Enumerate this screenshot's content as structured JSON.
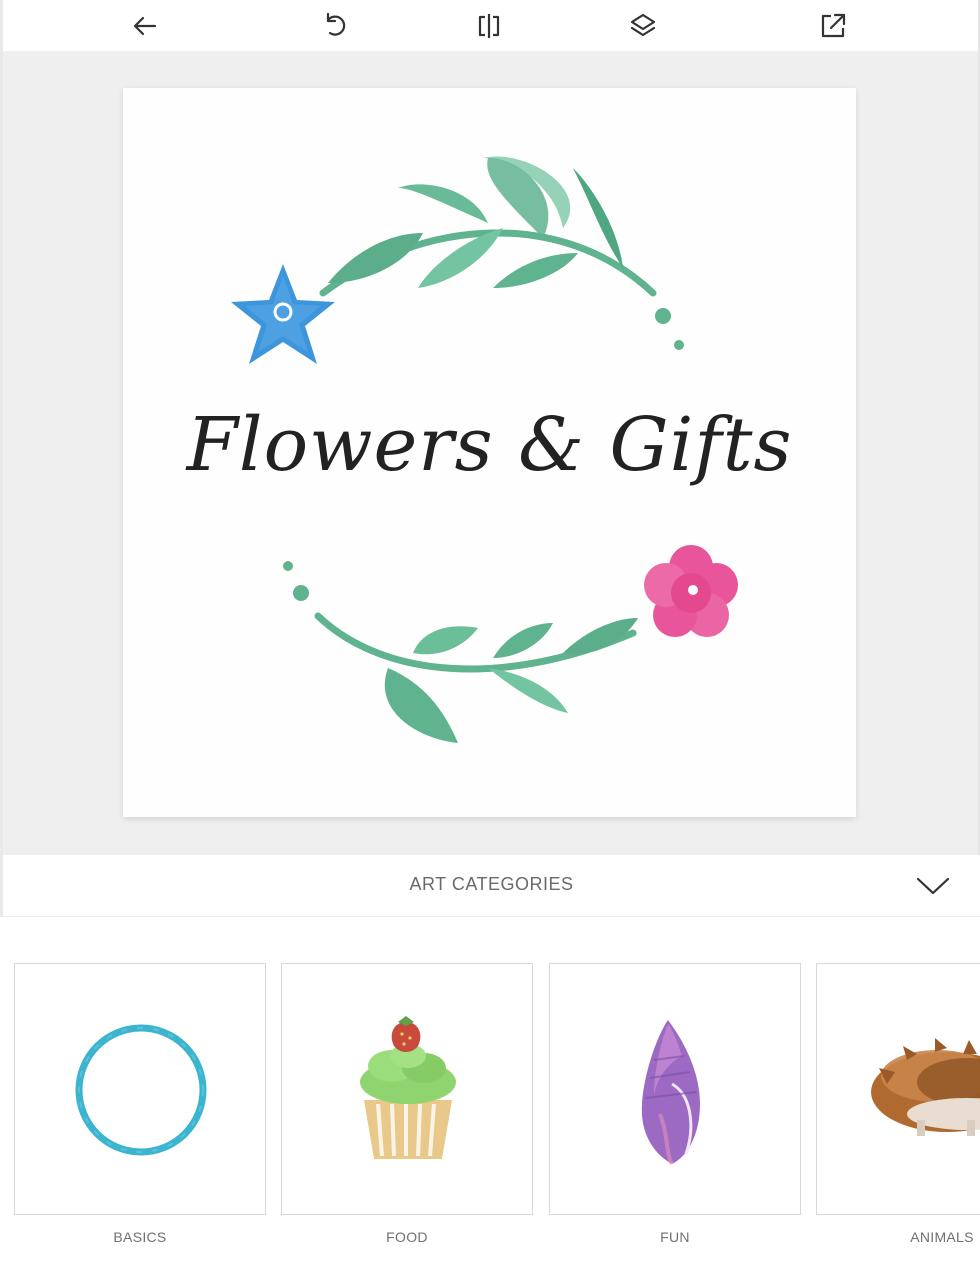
{
  "toolbar": {
    "back_icon": "arrow-left-icon",
    "undo_icon": "undo-icon",
    "flip_icon": "flip-horizontal-icon",
    "layers_icon": "layers-icon",
    "export_icon": "external-share-icon"
  },
  "artboard": {
    "logo_text": "Flowers & Gifts",
    "colors": {
      "leaf": "#5fb38f",
      "blue_flower": "#3d95dc",
      "pink_flower": "#e8559b",
      "text": "#222222",
      "canvas_bg": "#efefef"
    }
  },
  "categories": {
    "title": "ART CATEGORIES",
    "chevron_icon": "chevron-down-icon",
    "items": [
      {
        "label": "BASICS",
        "icon": "circle-ring-art"
      },
      {
        "label": "FOOD",
        "icon": "cupcake-art"
      },
      {
        "label": "FUN",
        "icon": "seashell-art"
      },
      {
        "label": "ANIMALS",
        "icon": "hedgehog-art"
      }
    ]
  }
}
